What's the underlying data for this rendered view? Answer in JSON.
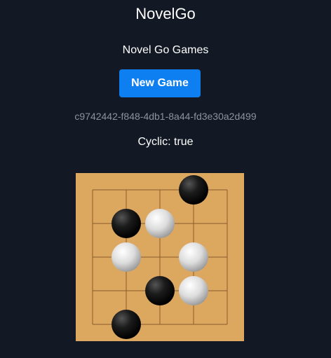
{
  "app": {
    "title": "NovelGo",
    "subtitle": "Novel Go Games"
  },
  "controls": {
    "new_game_label": "New Game",
    "new_game_color": "#0d7ff0"
  },
  "game": {
    "id": "c9742442-f848-4db1-8a44-fd3e30a2d499",
    "cyclic_text": "Cyclic: true",
    "board": {
      "size": 5,
      "background_color": "#dca860",
      "line_color": "#8a5a2a",
      "stones": [
        {
          "color": "black",
          "col": 3,
          "row": 0
        },
        {
          "color": "black",
          "col": 1,
          "row": 1
        },
        {
          "color": "white",
          "col": 2,
          "row": 1
        },
        {
          "color": "white",
          "col": 1,
          "row": 2
        },
        {
          "color": "white",
          "col": 3,
          "row": 2
        },
        {
          "color": "black",
          "col": 2,
          "row": 3
        },
        {
          "color": "white",
          "col": 3,
          "row": 3
        },
        {
          "color": "black",
          "col": 1,
          "row": 4
        }
      ]
    }
  }
}
